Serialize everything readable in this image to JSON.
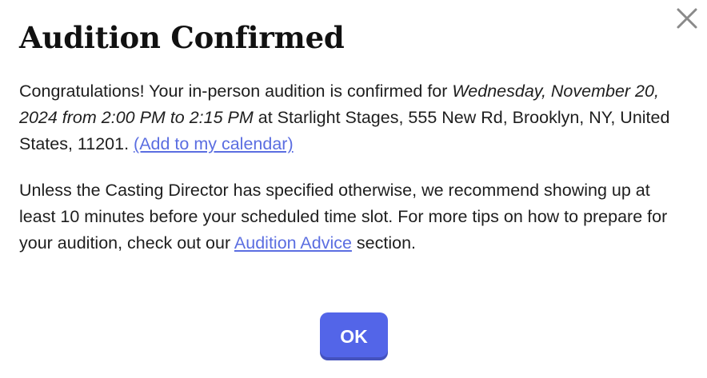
{
  "dialog": {
    "title": "Audition Confirmed",
    "close_icon": "close-icon",
    "p1": {
      "prefix": "Congratulations! Your in-person audition is confirmed for ",
      "datetime": "Wednesday, November 20, 2024 from 2:00 PM to 2:15 PM",
      "location": " at Starlight Stages, 555 New Rd, Brooklyn, NY, United States, 11201. ",
      "calendar_link": "(Add to my calendar)"
    },
    "p2": {
      "text": "Unless the Casting Director has specified otherwise, we recommend showing up at least 10 minutes before your scheduled time slot. For more tips on how to prepare for your audition, check out our ",
      "advice_link": "Audition Advice",
      "suffix": " section."
    },
    "ok_label": "OK"
  },
  "colors": {
    "link": "#5b6ee1",
    "button": "#5365e8",
    "title": "#111111",
    "text": "#1e1e1e",
    "close_icon": "#8a8a8a"
  }
}
